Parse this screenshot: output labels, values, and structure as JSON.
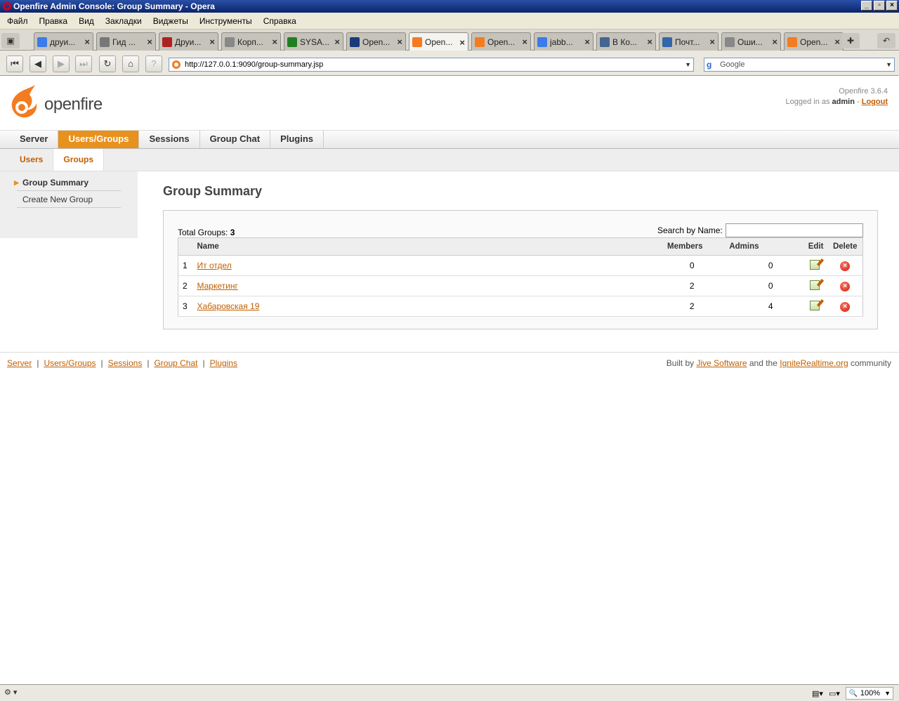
{
  "window": {
    "title": "Openfire Admin Console: Group Summary - Opera"
  },
  "menu": [
    "Файл",
    "Правка",
    "Вид",
    "Закладки",
    "Виджеты",
    "Инструменты",
    "Справка"
  ],
  "tabs": [
    {
      "label": "друи...",
      "icon": "google-icon",
      "color": "#3b7bea",
      "active": false
    },
    {
      "label": "Гид ...",
      "icon": "page-icon",
      "color": "#777777",
      "active": false
    },
    {
      "label": "Друи...",
      "icon": "feather-icon",
      "color": "#b02020",
      "active": false
    },
    {
      "label": "Корп...",
      "icon": "document-icon",
      "color": "#888888",
      "active": false
    },
    {
      "label": "SYSA...",
      "icon": "sysa-icon",
      "color": "#208020",
      "active": false
    },
    {
      "label": "Open...",
      "icon": "ru-icon",
      "color": "#1a3a7a",
      "active": false
    },
    {
      "label": "Open...",
      "icon": "openfire-icon",
      "color": "#f47b20",
      "active": true
    },
    {
      "label": "Open...",
      "icon": "openfire-icon",
      "color": "#f47b20",
      "active": false
    },
    {
      "label": "jabb...",
      "icon": "google-icon",
      "color": "#3b7bea",
      "active": false
    },
    {
      "label": "В Ко...",
      "icon": "vk-icon",
      "color": "#45668e",
      "active": false
    },
    {
      "label": "Почт...",
      "icon": "mail-icon",
      "color": "#3366aa",
      "active": false
    },
    {
      "label": "Оши...",
      "icon": "document-icon",
      "color": "#888888",
      "active": false
    },
    {
      "label": "Open...",
      "icon": "openfire-icon",
      "color": "#f47b20",
      "active": false
    }
  ],
  "address": {
    "url": "http://127.0.0.1:9090/group-summary.jsp",
    "search_placeholder": "Google"
  },
  "header": {
    "logo_text": "openfire",
    "version": "Openfire 3.6.4",
    "logged_in_prefix": "Logged in as",
    "user": "admin",
    "logout": "Logout"
  },
  "mainnav": [
    "Server",
    "Users/Groups",
    "Sessions",
    "Group Chat",
    "Plugins"
  ],
  "mainnav_active": "Users/Groups",
  "subnav": [
    "Users",
    "Groups"
  ],
  "sidebar": {
    "items": [
      "Group Summary",
      "Create New Group"
    ]
  },
  "page": {
    "title": "Group Summary",
    "total_label": "Total Groups:",
    "total_value": "3",
    "search_label": "Search by Name:",
    "columns": {
      "name": "Name",
      "members": "Members",
      "admins": "Admins",
      "edit": "Edit",
      "delete": "Delete"
    },
    "rows": [
      {
        "index": "1",
        "name": "Ит отдел",
        "members": "0",
        "admins": "0"
      },
      {
        "index": "2",
        "name": "Маркетинг",
        "members": "2",
        "admins": "0"
      },
      {
        "index": "3",
        "name": "Хабаровская 19",
        "members": "2",
        "admins": "4"
      }
    ]
  },
  "footer": {
    "links": [
      "Server",
      "Users/Groups",
      "Sessions",
      "Group Chat",
      "Plugins"
    ],
    "credit_prefix": "Built by",
    "credit_link1": "Jive Software",
    "credit_mid": "and the",
    "credit_link2": "IgniteRealtime.org",
    "credit_suffix": "community"
  },
  "statusbar": {
    "zoom": "100%"
  },
  "colors": {
    "accent": "#e8911d",
    "link": "#c15f00"
  }
}
